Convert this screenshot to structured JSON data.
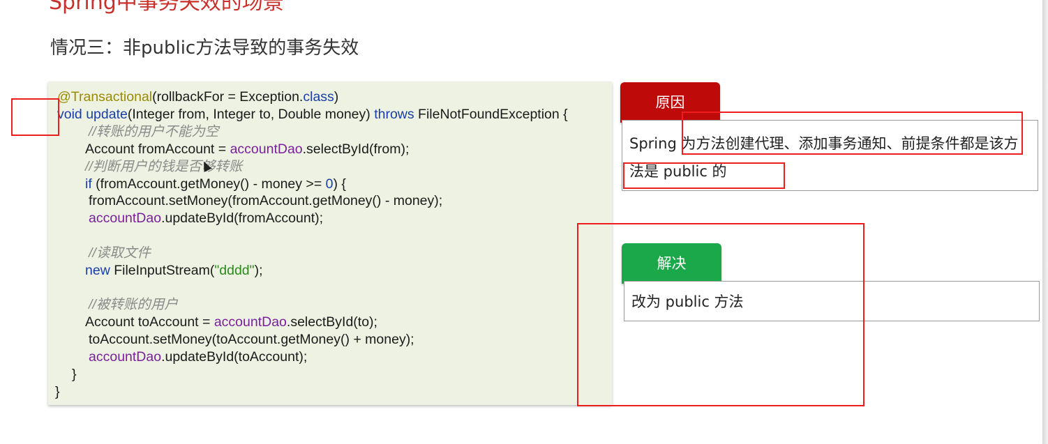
{
  "slide": {
    "top_title": "Spring中事务失效的场景",
    "subtitle": "情况三：非public方法导致的事务失效"
  },
  "code": {
    "line1": {
      "annotation": "@Transactional",
      "a": "(rollbackFor = Exception.",
      "kw_class": "class",
      "b": ")"
    },
    "line2": {
      "kw_void": "void",
      "method": "update",
      "params": "(Integer from, Integer to, Double money) ",
      "kw_throws": "throws",
      "rest": " FileNotFoundException {"
    },
    "line3": {
      "comment": "//转账的用户不能为空"
    },
    "line4": {
      "a": "Account fromAccount = ",
      "field": "accountDao",
      "b": ".selectById(from);"
    },
    "line5": {
      "comment": "//判断用户的钱是否够转账"
    },
    "line6": {
      "kw_if": "if",
      "a": " (fromAccount.getMoney() - money >= ",
      "num": "0",
      "b": ") {"
    },
    "line7": {
      "a": "fromAccount.setMoney(fromAccount.getMoney() - money);"
    },
    "line8": {
      "field": "accountDao",
      "b": ".updateById(fromAccount);"
    },
    "line9": {
      "comment": "//读取文件"
    },
    "line10": {
      "kw_new": "new",
      "a": " FileInputStream(",
      "str": "\"dddd\"",
      "b": ");"
    },
    "line11": {
      "comment": "//被转账的用户"
    },
    "line12": {
      "a": "Account toAccount = ",
      "field": "accountDao",
      "b": ".selectById(to);"
    },
    "line13": {
      "a": "toAccount.setMoney(toAccount.getMoney() + money);"
    },
    "line14": {
      "field": "accountDao",
      "b": ".updateById(toAccount);"
    },
    "line15": {
      "a": "}"
    },
    "line16": {
      "a": "}"
    }
  },
  "reason": {
    "badge": "原因",
    "text": "Spring 为方法创建代理、添加事务通知、前提条件都是该方法是 public 的"
  },
  "solution": {
    "badge": "解决",
    "text": "改为 public 方法"
  },
  "colors": {
    "code_bg": "#edf2e2",
    "reason_badge": "#bf0a0a",
    "solution_badge": "#1aa84a",
    "highlight": "#ee1c1c",
    "title": "#c9302c"
  }
}
